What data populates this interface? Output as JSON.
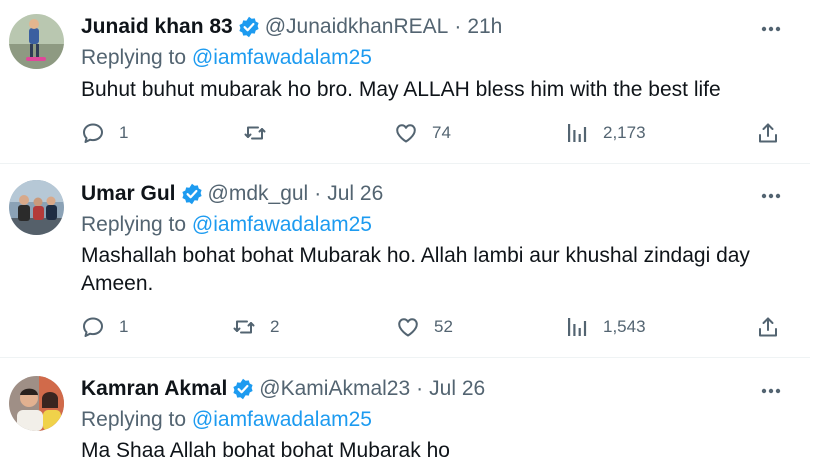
{
  "tweets": [
    {
      "name": "Junaid khan 83",
      "handle": "@JunaidkhanREAL",
      "separator": "·",
      "time": "21h",
      "replying_prefix": "Replying to ",
      "replying_to": "@iamfawadalam25",
      "text": "Buhut buhut mubarak ho bro. May ALLAH bless him with the best life",
      "replies": "1",
      "retweets": "",
      "likes": "74",
      "views": "2,173"
    },
    {
      "name": "Umar Gul",
      "handle": "@mdk_gul",
      "separator": "·",
      "time": "Jul 26",
      "replying_prefix": "Replying to ",
      "replying_to": "@iamfawadalam25",
      "text": "Mashallah bohat bohat Mubarak ho. Allah lambi aur khushal zindagi day Ameen.",
      "replies": "1",
      "retweets": "2",
      "likes": "52",
      "views": "1,543"
    },
    {
      "name": "Kamran Akmal",
      "handle": "@KamiAkmal23",
      "separator": "·",
      "time": "Jul 26",
      "replying_prefix": "Replying to ",
      "replying_to": "@iamfawadalam25",
      "text": "Ma Shaa Allah bohat bohat Mubarak ho"
    }
  ],
  "icons": {
    "verified": "verified-badge-icon",
    "more": "more-horizontal-icon",
    "reply": "reply-icon",
    "retweet": "retweet-icon",
    "like": "heart-icon",
    "views": "views-chart-icon",
    "share": "share-icon"
  },
  "colors": {
    "accent": "#1d9bf0",
    "secondary_text": "#536471",
    "primary_text": "#0f1419",
    "divider": "#eff3f4"
  }
}
